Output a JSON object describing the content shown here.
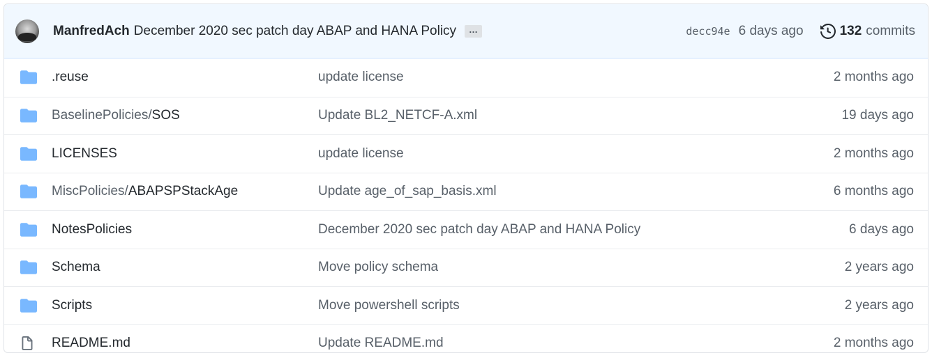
{
  "commit": {
    "author": "ManfredAch",
    "message": "December 2020 sec patch day ABAP and HANA Policy",
    "ellipsis": "…",
    "sha": "decc94e",
    "age": "6 days ago",
    "commit_count": "132",
    "commits_label": "commits"
  },
  "files": [
    {
      "icon": "folder-icon",
      "dir": "",
      "name": ".reuse",
      "message": "update license",
      "date": "2 months ago"
    },
    {
      "icon": "folder-icon",
      "dir": "BaselinePolicies/",
      "name": "SOS",
      "message": "Update BL2_NETCF-A.xml",
      "date": "19 days ago"
    },
    {
      "icon": "folder-icon",
      "dir": "",
      "name": "LICENSES",
      "message": "update license",
      "date": "2 months ago"
    },
    {
      "icon": "folder-icon",
      "dir": "MiscPolicies/",
      "name": "ABAPSPStackAge",
      "message": "Update age_of_sap_basis.xml",
      "date": "6 months ago"
    },
    {
      "icon": "folder-icon",
      "dir": "",
      "name": "NotesPolicies",
      "message": "December 2020 sec patch day ABAP and HANA Policy",
      "date": "6 days ago"
    },
    {
      "icon": "folder-icon",
      "dir": "",
      "name": "Schema",
      "message": "Move policy schema",
      "date": "2 years ago"
    },
    {
      "icon": "folder-icon",
      "dir": "",
      "name": "Scripts",
      "message": "Move powershell scripts",
      "date": "2 years ago"
    },
    {
      "icon": "file-icon",
      "dir": "",
      "name": "README.md",
      "message": "Update README.md",
      "date": "2 months ago"
    }
  ],
  "colors": {
    "folder": "#79b8ff",
    "header_bg": "#f1f8ff",
    "muted_text": "#586069"
  }
}
